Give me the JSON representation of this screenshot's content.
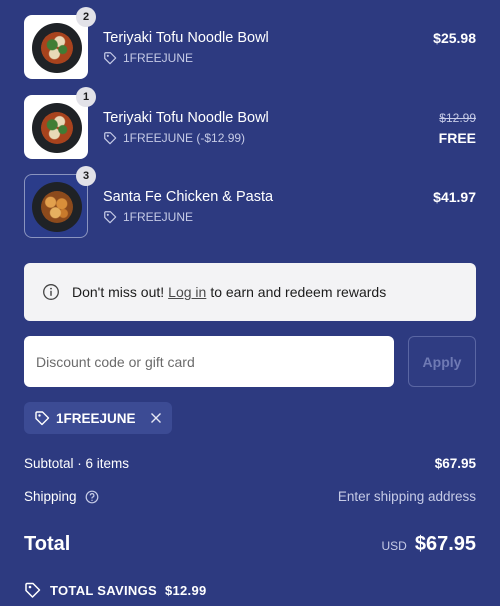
{
  "cart": {
    "items": [
      {
        "name": "Teriyaki Tofu Noodle Bowl",
        "quantity": "2",
        "discount": "1FREEJUNE",
        "price": "$25.98",
        "image": "teriyaki-tofu-bowl"
      },
      {
        "name": "Teriyaki Tofu Noodle Bowl",
        "quantity": "1",
        "discount": "1FREEJUNE (-$12.99)",
        "original_price": "$12.99",
        "price": "FREE",
        "image": "teriyaki-tofu-bowl"
      },
      {
        "name": "Santa Fe Chicken & Pasta",
        "quantity": "3",
        "discount": "1FREEJUNE",
        "price": "$41.97",
        "image": "santa-fe-chicken-pasta"
      }
    ]
  },
  "notice": {
    "icon": "info-icon",
    "before": "Don't miss out!",
    "link": "Log in",
    "after": "to earn and redeem rewards"
  },
  "discount": {
    "placeholder": "Discount code or gift card",
    "value": "",
    "apply_label": "Apply",
    "applied_code": "1FREEJUNE"
  },
  "summary": {
    "subtotal_label": "Subtotal · 6 items",
    "subtotal_value": "$67.95",
    "shipping_label": "Shipping",
    "shipping_value": "Enter shipping address",
    "total_label": "Total",
    "currency": "USD",
    "total_value": "$67.95",
    "savings_label": "TOTAL SAVINGS",
    "savings_value": "$12.99"
  },
  "colors": {
    "background": "#2d3a80",
    "chip": "#3c4b94",
    "notice_bg": "#f3f3f5"
  }
}
